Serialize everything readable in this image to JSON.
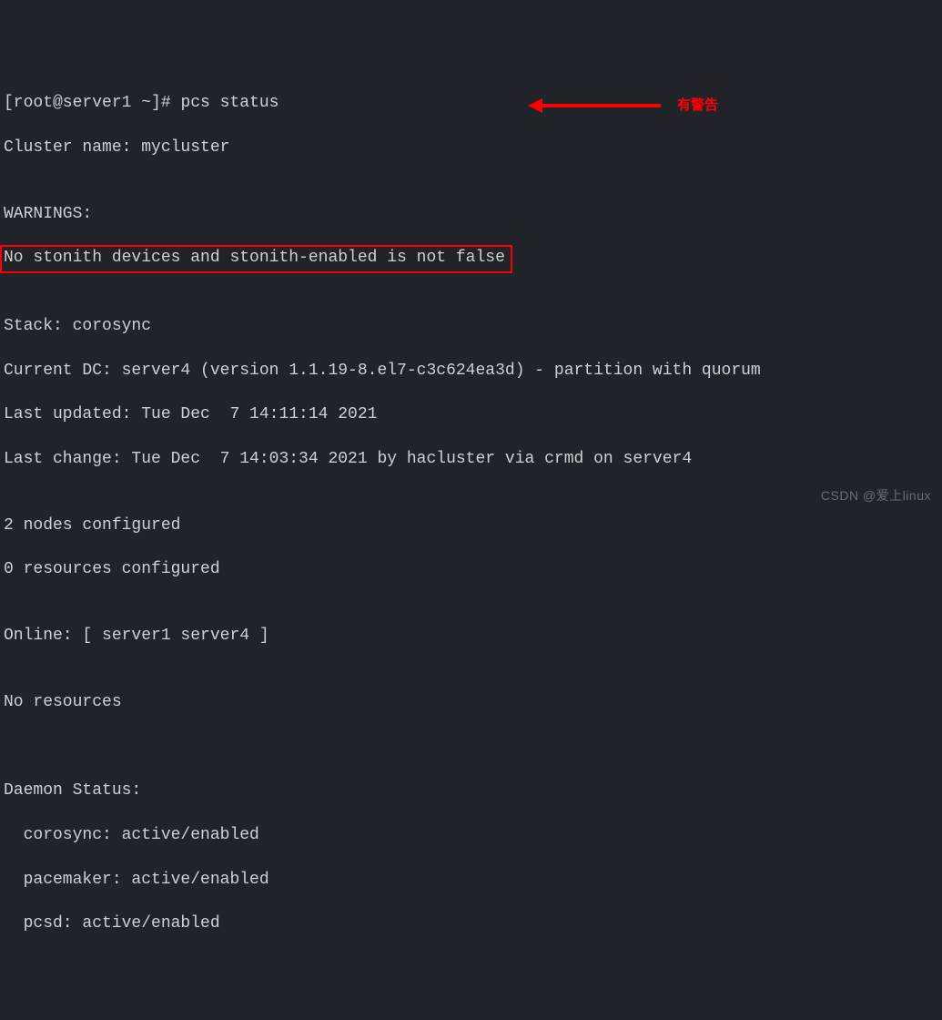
{
  "prompt": {
    "user_host": "[root@server1 ~]#",
    "command": "pcs status"
  },
  "output": {
    "cluster_name_line": "Cluster name: mycluster",
    "blank1": "",
    "warnings_header": "WARNINGS:",
    "warning_line": "No stonith devices and stonith-enabled is not false",
    "blank2": "",
    "stack": "Stack: corosync",
    "current_dc": "Current DC: server4 (version 1.1.19-8.el7-c3c624ea3d) - partition with quorum",
    "last_updated": "Last updated: Tue Dec  7 14:11:14 2021",
    "last_change": "Last change: Tue Dec  7 14:03:34 2021 by hacluster via crmd on server4",
    "blank3": "",
    "nodes_configured": "2 nodes configured",
    "resources_configured": "0 resources configured",
    "blank4": "",
    "online": "Online: [ server1 server4 ]",
    "blank5": "",
    "no_resources": "No resources",
    "blank6": "",
    "blank7": "",
    "daemon_header": "Daemon Status:",
    "daemon_corosync": "  corosync: active/enabled",
    "daemon_pacemaker": "  pacemaker: active/enabled",
    "daemon_pcsd": "  pcsd: active/enabled"
  },
  "annotation": {
    "label": "有警告"
  },
  "watermark": "CSDN @爱上linux"
}
